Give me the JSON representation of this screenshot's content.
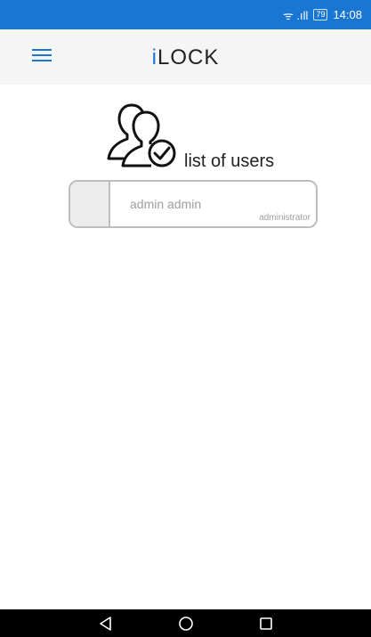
{
  "status_bar": {
    "signal": "ᯤ .ıll",
    "battery": "79",
    "time": "14:08"
  },
  "app_bar": {
    "title_prefix": "i",
    "title_rest": "LOCK",
    "menu_icon": "hamburger-menu-icon"
  },
  "users": {
    "heading": "list of users",
    "icon": "users-check-icon",
    "items": [
      {
        "name": "admin admin",
        "role": "administrator"
      }
    ]
  },
  "nav_bar": {
    "back_icon": "back-triangle-icon",
    "home_icon": "home-circle-icon",
    "recents_icon": "recents-square-icon"
  },
  "colors": {
    "primary": "#1976d2",
    "app_bar_bg": "#f5f5f5",
    "card_border": "#bdbdbd"
  }
}
